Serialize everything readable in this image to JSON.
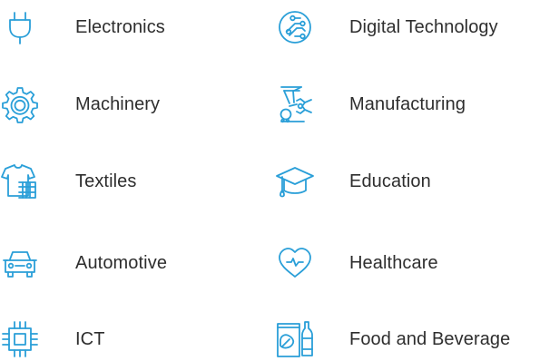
{
  "icon_color": "#2a9fd8",
  "text_color": "#2e2e2e",
  "industries": {
    "left": [
      {
        "label": "Electronics",
        "icon": "plug-icon"
      },
      {
        "label": "Machinery",
        "icon": "gear-icon"
      },
      {
        "label": "Textiles",
        "icon": "tshirt-icon"
      },
      {
        "label": "Automotive",
        "icon": "car-icon"
      },
      {
        "label": "ICT",
        "icon": "chip-icon"
      }
    ],
    "right": [
      {
        "label": "Digital Technology",
        "icon": "circuit-icon"
      },
      {
        "label": "Manufacturing",
        "icon": "robot-arm-icon"
      },
      {
        "label": "Education",
        "icon": "graduation-cap-icon"
      },
      {
        "label": "Healthcare",
        "icon": "heart-pulse-icon"
      },
      {
        "label": "Food and Beverage",
        "icon": "food-bottle-icon"
      }
    ]
  }
}
